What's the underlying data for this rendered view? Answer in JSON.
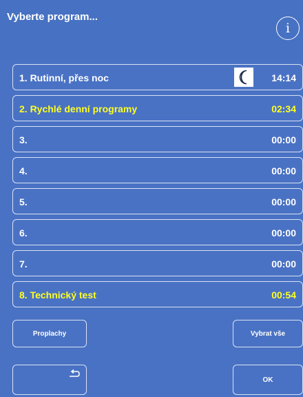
{
  "header": {
    "title": "Vyberte program...",
    "info_icon": "info-icon",
    "info_glyph": "i"
  },
  "programs": [
    {
      "label": "1. Rutinní, přes noc",
      "time": "14:14",
      "icon": "moon-icon",
      "color": "#ffffff"
    },
    {
      "label": "2. Rychlé denní programy",
      "time": "02:34",
      "color": "#ffff22"
    },
    {
      "label": "3.",
      "time": "00:00",
      "color": "#ffffff"
    },
    {
      "label": "4.",
      "time": "00:00",
      "color": "#ffffff"
    },
    {
      "label": "5.",
      "time": "00:00",
      "color": "#ffffff"
    },
    {
      "label": "6.",
      "time": "00:00",
      "color": "#ffffff"
    },
    {
      "label": "7.",
      "time": "00:00",
      "color": "#ffffff"
    },
    {
      "label": "8. Technický test",
      "time": "00:54",
      "color": "#ffff22"
    }
  ],
  "buttons": {
    "flush_label": "Proplachy",
    "select_all_label": "Vybrat vše",
    "back_icon": "back-arrow-icon",
    "ok_label": "OK"
  },
  "colors": {
    "background": "#4a72c4",
    "highlight_text": "#ffff22",
    "text": "#ffffff"
  }
}
